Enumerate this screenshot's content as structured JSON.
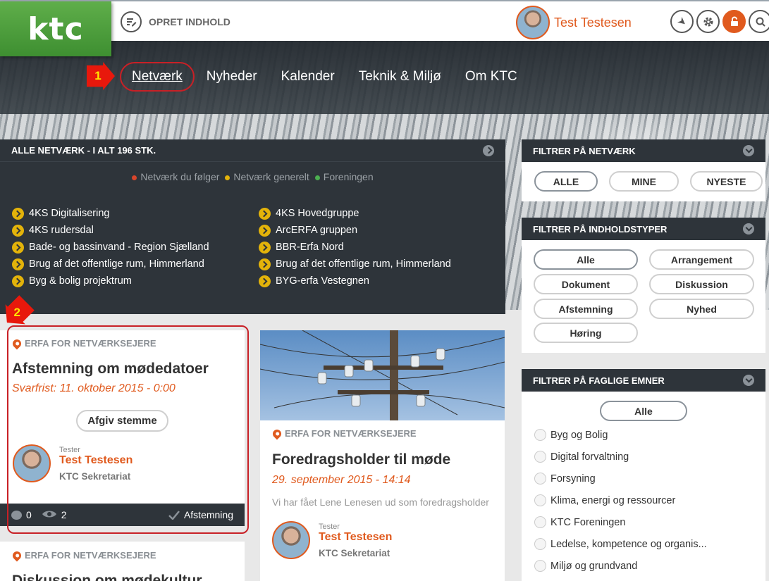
{
  "header": {
    "logo": "ktc",
    "create_label": "OPRET INDHOLD",
    "user_name": "Test Testesen",
    "icons": [
      "arrow-down-icon",
      "gear-icon",
      "unlock-icon",
      "search-icon"
    ]
  },
  "nav": {
    "items": [
      "Netværk",
      "Nyheder",
      "Kalender",
      "Teknik & Miljø",
      "Om KTC"
    ],
    "active_index": 0
  },
  "markers": {
    "m1": "1",
    "m2": "2"
  },
  "networks": {
    "title": "ALLE NETVÆRK - I ALT 196 STK.",
    "legend": [
      {
        "label": "Netværk du følger",
        "color": "#d9452b"
      },
      {
        "label": "Netværk generelt",
        "color": "#e3b30a"
      },
      {
        "label": "Foreningen",
        "color": "#4caf50"
      }
    ],
    "items": [
      "4KS Digitalisering",
      "4KS Hovedgruppe",
      "4KS rudersdal",
      "ArcERFA gruppen",
      "Bade- og bassinvand - Region Sjælland",
      "BBR-Erfa Nord",
      "Brug af det offentlige rum, Himmerland",
      "Brug af det offentlige rum, Himmerland",
      "Byg & bolig projektrum",
      "BYG-erfa Vestegnen"
    ]
  },
  "filter_network": {
    "title": "FILTRER PÅ NETVÆRK",
    "options": [
      "ALLE",
      "MINE",
      "NYESTE"
    ]
  },
  "filter_types": {
    "title": "FILTRER PÅ INDHOLDSTYPER",
    "options": [
      "Alle",
      "Arrangement",
      "Dokument",
      "Diskussion",
      "Afstemning",
      "Nyhed",
      "Høring"
    ]
  },
  "filter_topics": {
    "title": "FILTRER PÅ FAGLIGE EMNER",
    "all_label": "Alle",
    "topics": [
      "Byg og Bolig",
      "Digital forvaltning",
      "Forsyning",
      "Klima, energi og ressourcer",
      "KTC Foreningen",
      "Ledelse, kompetence og organis...",
      "Miljø og grundvand"
    ]
  },
  "cards": {
    "poll": {
      "category": "ERFA FOR NETVÆRKSEJERE",
      "title": "Afstemning om mødedatoer",
      "deadline": "Svarfrist: 11. oktober 2015 - 0:00",
      "button": "Afgiv stemme",
      "role": "Tester",
      "author": "Test Testesen",
      "org": "KTC Sekretariat",
      "comments": "0",
      "views": "2",
      "type": "Afstemning"
    },
    "news": {
      "category": "ERFA FOR NETVÆRKSEJERE",
      "title": "Foredragsholder til møde",
      "date": "29. september 2015 - 14:14",
      "excerpt": "Vi har fået Lene Lenesen ud som foredragsholder",
      "role": "Tester",
      "author": "Test Testesen",
      "org": "KTC Sekretariat"
    },
    "discussion": {
      "category": "ERFA FOR NETVÆRKSEJERE",
      "title": "Diskussion om mødekultur"
    }
  }
}
